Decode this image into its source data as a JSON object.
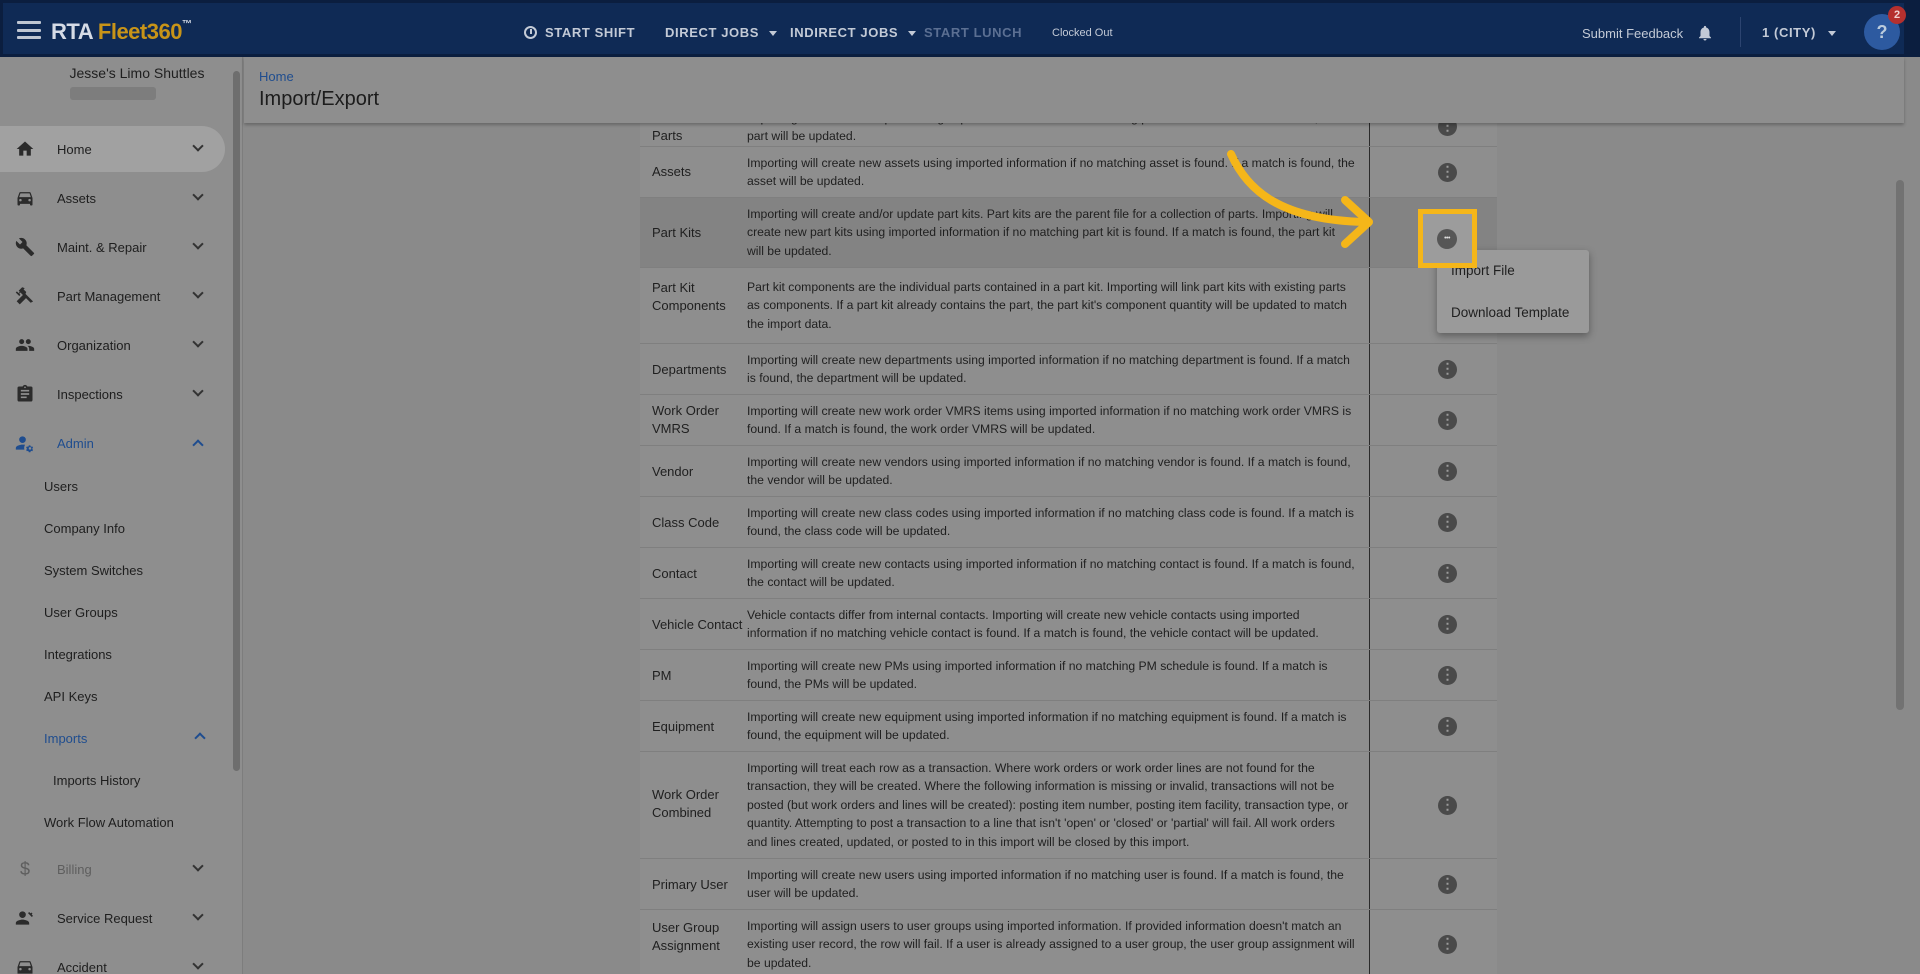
{
  "topbar": {
    "logo_rta": "RTA ",
    "logo_fleet": "Fleet360",
    "logo_tm": "™",
    "start_shift": "START SHIFT",
    "direct_jobs": "DIRECT JOBS",
    "indirect_jobs": "INDIRECT JOBS",
    "start_lunch": "START LUNCH",
    "clocked_status": "Clocked Out",
    "submit_feedback": "Submit Feedback",
    "location": "1 (CITY)",
    "help_badge": "2",
    "colors": {
      "bar": "#0f2a55",
      "accent": "#c89418",
      "highlight": "#f5b619"
    }
  },
  "sidebar": {
    "company_name": "Jesse's Limo Shuttles",
    "items": [
      {
        "label": "Home",
        "icon": "home-icon"
      },
      {
        "label": "Assets",
        "icon": "car-icon"
      },
      {
        "label": "Maint. & Repair",
        "icon": "wrench-icon"
      },
      {
        "label": "Part Management",
        "icon": "tools-icon"
      },
      {
        "label": "Organization",
        "icon": "people-icon"
      },
      {
        "label": "Inspections",
        "icon": "clipboard-icon"
      },
      {
        "label": "Admin",
        "icon": "user-gear-icon"
      },
      {
        "label": "Billing",
        "icon": "dollar-icon"
      },
      {
        "label": "Service Request",
        "icon": "person-wrench-icon"
      },
      {
        "label": "Accident",
        "icon": "car-crash-icon"
      }
    ],
    "admin_sub": [
      "Users",
      "Company Info",
      "System Switches",
      "User Groups",
      "Integrations",
      "API Keys",
      "Imports",
      "Imports History",
      "Work Flow Automation"
    ]
  },
  "header": {
    "breadcrumb": "Home",
    "title": "Import/Export"
  },
  "rows": [
    {
      "name": "Parts",
      "desc": "Importing will create new parts using imported information if no matching part is found. If a match is found, the part will be updated."
    },
    {
      "name": "Assets",
      "desc": "Importing will create new assets using imported information if no matching asset is found. If a match is found, the asset will be updated."
    },
    {
      "name": "Part Kits",
      "desc": "Importing will create and/or update part kits. Part kits are the parent file for a collection of parts. Importing will create new part kits using imported information if no matching part kit is found. If a match is found, the part kit will be updated."
    },
    {
      "name": "Part Kit Components",
      "desc": "Part kit components are the individual parts contained in a part kit. Importing will link part kits with existing parts as components. If a part kit already contains the part, the part kit's component quantity will be updated to match the import data."
    },
    {
      "name": "Departments",
      "desc": "Importing will create new departments using imported information if no matching department is found. If a match is found, the department will be updated."
    },
    {
      "name": "Work Order VMRS",
      "desc": "Importing will create new work order VMRS items using imported information if no matching work order VMRS is found. If a match is found, the work order VMRS will be updated."
    },
    {
      "name": "Vendor",
      "desc": "Importing will create new vendors using imported information if no matching vendor is found. If a match is found, the vendor will be updated."
    },
    {
      "name": "Class Code",
      "desc": "Importing will create new class codes using imported information if no matching class code is found. If a match is found, the class code will be updated."
    },
    {
      "name": "Contact",
      "desc": "Importing will create new contacts using imported information if no matching contact is found. If a match is found, the contact will be updated."
    },
    {
      "name": "Vehicle Contact",
      "desc": "Vehicle contacts differ from internal contacts. Importing will create new vehicle contacts using imported information if no matching vehicle contact is found. If a match is found, the vehicle contact will be updated."
    },
    {
      "name": "PM",
      "desc": "Importing will create new PMs using imported information if no matching PM schedule is found. If a match is found, the PMs will be updated."
    },
    {
      "name": "Equipment",
      "desc": "Importing will create new equipment using imported information if no matching equipment is found. If a match is found, the equipment will be updated."
    },
    {
      "name": "Work Order Combined",
      "desc": "Importing will treat each row as a transaction. Where work orders or work order lines are not found for the transaction, they will be created. Where the following information is missing or invalid, transactions will not be posted (but work orders and lines will be created): posting item number, posting item facility, transaction type, or quantity. Attempting to post a transaction to a line that isn't 'open' or 'closed' or 'partial' will fail. All work orders and lines created, updated, or posted to in this import will be closed by this import."
    },
    {
      "name": "Primary User",
      "desc": "Importing will create new users using imported information if no matching user is found. If a match is found, the user will be updated."
    },
    {
      "name": "User Group Assignment",
      "desc": "Importing will assign users to user groups using imported information. If provided information doesn't match an existing user record, the row will fail. If a user is already assigned to a user group, the user group assignment will be updated."
    }
  ],
  "popup": {
    "import_file": "Import File",
    "download_template": "Download Template"
  }
}
